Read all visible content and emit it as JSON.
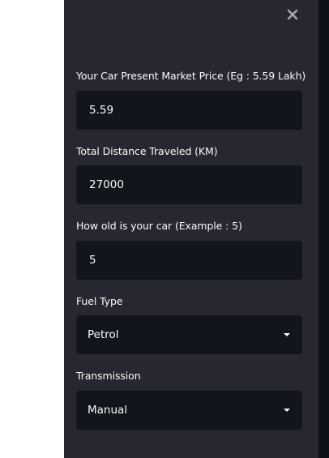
{
  "sidebar": {
    "close_glyph": "✕",
    "fields": {
      "price": {
        "label": "Your Car Present Market Price (Eg : 5.59 Lakh)",
        "value": "5.59"
      },
      "distance": {
        "label": "Total Distance Traveled (KM)",
        "value": "27000"
      },
      "age": {
        "label": "How old is your car (Example : 5)",
        "value": "5"
      },
      "fuel": {
        "label": "Fuel Type",
        "selected": "Petrol"
      },
      "transmission": {
        "label": "Transmission",
        "selected": "Manual"
      }
    }
  },
  "colors": {
    "sidebar_bg": "#262730",
    "input_bg": "#13151c",
    "text": "#fafafa",
    "close_icon": "#a3a6ad"
  }
}
